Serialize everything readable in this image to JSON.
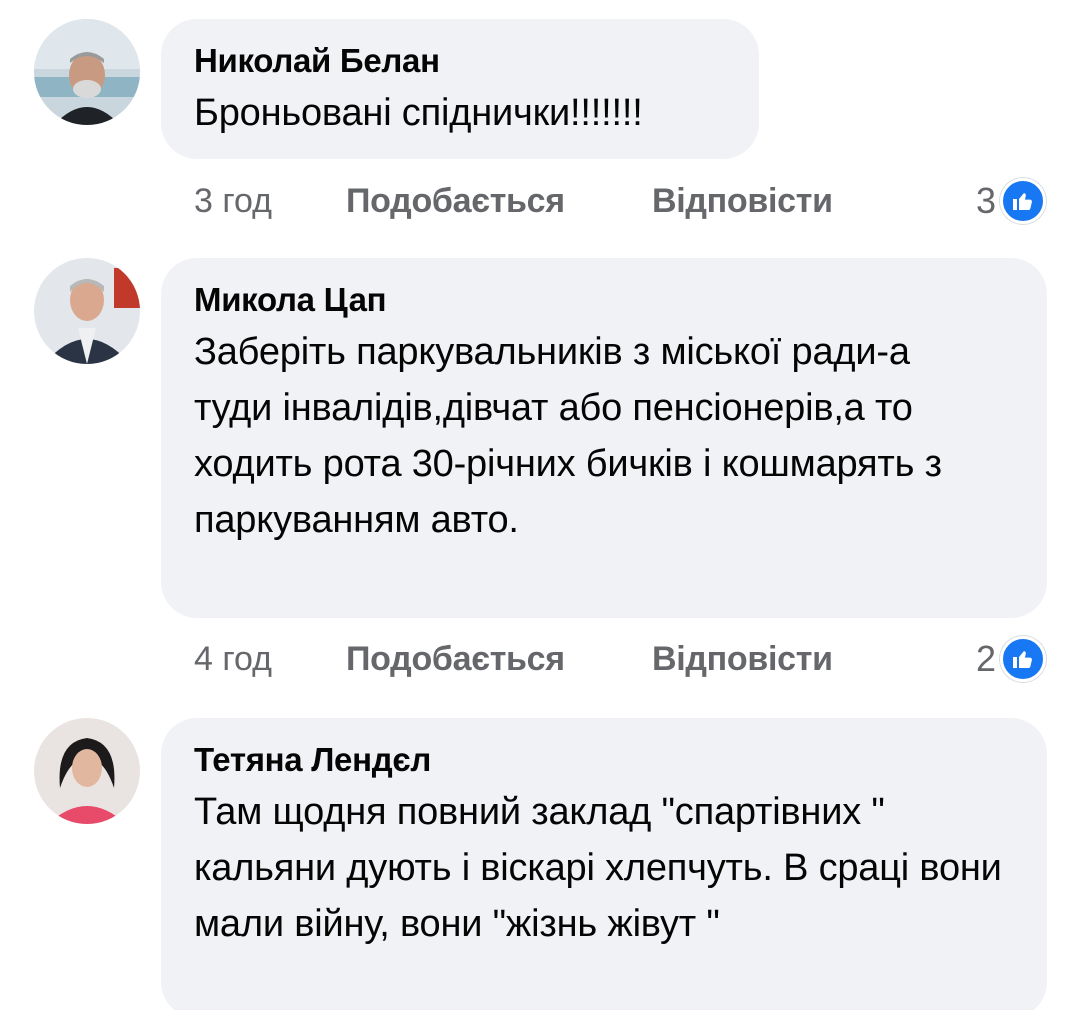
{
  "comments": [
    {
      "author": "Николай Белан",
      "text": "Броньовані спіднички!!!!!!!",
      "time": "3 год",
      "like_label": "Подобається",
      "reply_label": "Відповісти",
      "reaction_count": "3"
    },
    {
      "author": "Микола Цап",
      "text": "Заберіть паркувальників з міської ради-а туди інвалідів,дівчат або пенсіонерів,а то ходить рота 30-річних бичків і кошмарять з паркуванням авто.",
      "time": "4 год",
      "like_label": "Подобається",
      "reply_label": "Відповісти",
      "reaction_count": "2"
    },
    {
      "author": "Тетяна Лендєл",
      "text": "Там щодня повний заклад \"спартівних \" кальяни дують і віскарі хлепчуть. В сраці вони мали війну, вони \"жізнь жівут \""
    }
  ],
  "colors": {
    "bubble": "#f0f2f5",
    "meta": "#65676b",
    "like_blue": "#1877f2"
  },
  "icons": {
    "reaction": "thumbs-up-icon"
  }
}
